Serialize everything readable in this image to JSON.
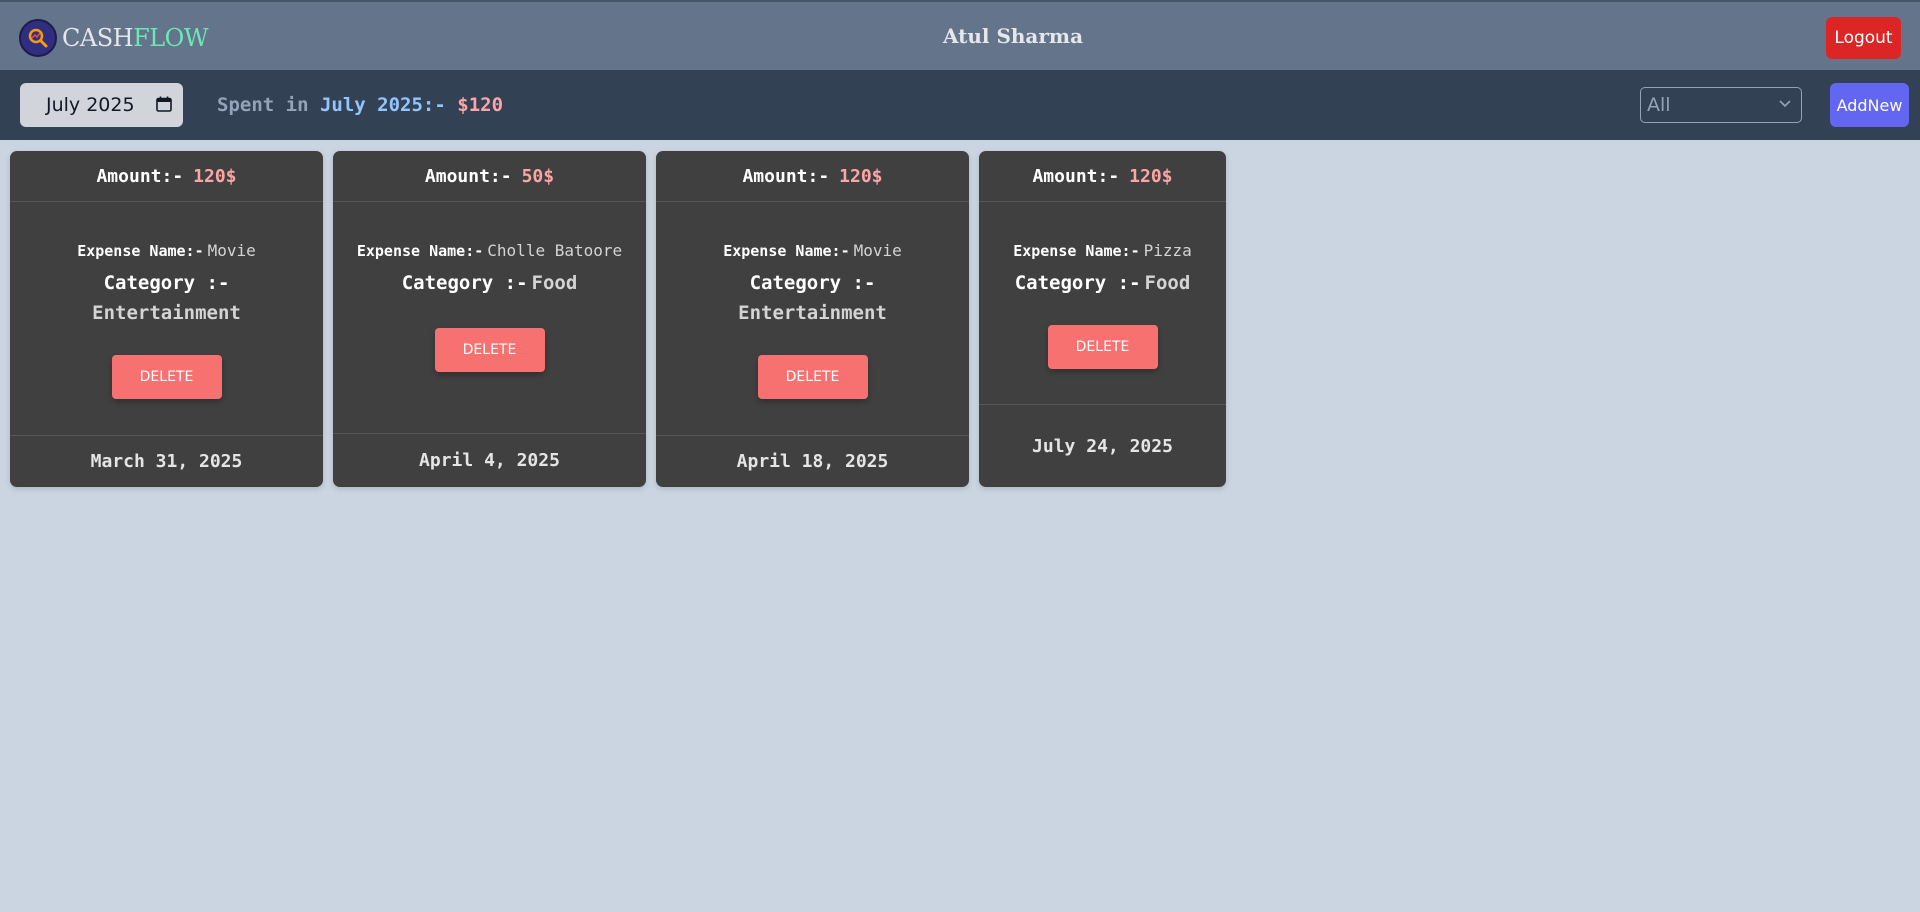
{
  "header": {
    "logo_cash": "CASH",
    "logo_flow": "FLOW",
    "user_name": "Atul Sharma",
    "logout_label": "Logout"
  },
  "toolbar": {
    "month_value": "July 2025",
    "spent_label": "Spent in",
    "spent_month": "July 2025:-",
    "spent_amount": "$120",
    "filter_selected": "All",
    "addnew_label": "AddNew"
  },
  "cards": [
    {
      "amount_label": "Amount:-",
      "amount": "120$",
      "name_label": "Expense Name:-",
      "name": "Movie",
      "category_label": "Category :-",
      "category": "Entertainment",
      "delete_label": "DELETE",
      "date": "March 31, 2025"
    },
    {
      "amount_label": "Amount:-",
      "amount": "50$",
      "name_label": "Expense Name:-",
      "name": "Cholle Batoore",
      "category_label": "Category :-",
      "category": "Food",
      "delete_label": "DELETE",
      "date": "April 4, 2025"
    },
    {
      "amount_label": "Amount:-",
      "amount": "120$",
      "name_label": "Expense Name:-",
      "name": "Movie",
      "category_label": "Category :-",
      "category": "Entertainment",
      "delete_label": "DELETE",
      "date": "April 18, 2025"
    },
    {
      "amount_label": "Amount:-",
      "amount": "120$",
      "name_label": "Expense Name:-",
      "name": "Pizza",
      "category_label": "Category :-",
      "category": "Food",
      "delete_label": "DELETE",
      "date": "July 24, 2025"
    }
  ],
  "colors": {
    "page_bg": "#cbd5e1",
    "topbar_bg": "#64748b",
    "subbar_bg": "#334155",
    "card_bg": "#404040",
    "accent_amount": "#fca5a5",
    "delete_btn": "#f87171",
    "logout_btn": "#dc2626",
    "addnew_btn": "#6366f1"
  }
}
